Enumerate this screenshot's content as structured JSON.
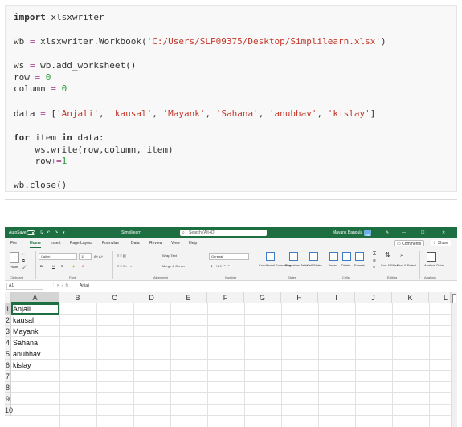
{
  "code": {
    "l1_kw": "import",
    "l1_rest": " xlsxwriter",
    "l2_a": "wb ",
    "l2_op": "=",
    "l2_b": " xlsxwriter.Workbook(",
    "l2_str": "'C:/Users/SLP09375/Desktop/Simplilearn.xlsx'",
    "l2_c": ")",
    "l3_a": "ws ",
    "l3_op": "=",
    "l3_b": " wb.add_worksheet()",
    "l4_a": "row ",
    "l4_op": "=",
    "l4_num": " 0",
    "l5_a": "column ",
    "l5_op": "=",
    "l5_num": " 0",
    "l6_a": "data ",
    "l6_op": "=",
    "l6_b": " [",
    "l6_s1": "'Anjali'",
    "l6_s2": "'kausal'",
    "l6_s3": "'Mayank'",
    "l6_s4": "'Sahana'",
    "l6_s5": "'anubhav'",
    "l6_s6": "'kislay'",
    "l6_comma": ", ",
    "l6_end": "]",
    "l7_kw1": "for",
    "l7_mid": " item ",
    "l7_kw2": "in",
    "l7_rest": " data:",
    "l8": "    ws.write(row,column, item)",
    "l9_a": "    row",
    "l9_op": "+=",
    "l9_num": "1",
    "l10": "wb.close()"
  },
  "excel": {
    "autosave": "AutoSave",
    "filename": "Simplilearn",
    "search_placeholder": "Search (Alt+Q)",
    "user_name": "Mayank Banoula",
    "user_initials": "MB",
    "window_controls": [
      "—",
      "☐",
      "✕"
    ],
    "menu": [
      "File",
      "Home",
      "Insert",
      "Page Layout",
      "Formulas",
      "Data",
      "Review",
      "View",
      "Help"
    ],
    "active_menu": "Home",
    "comments_label": "Comments",
    "share_label": "Share",
    "ribbon": {
      "paste": "Paste",
      "font_name": "Calibri",
      "font_size": "11",
      "wrap_text": "Wrap Text",
      "merge_center": "Merge & Center",
      "number_format": "General",
      "conditional_formatting": "Conditional Formatting",
      "format_as_table": "Format as Table",
      "cell_styles": "Cell Styles",
      "insert": "Insert",
      "delete": "Delete",
      "format": "Format",
      "sort_filter": "Sort & Filter",
      "find_select": "Find & Select",
      "analyze_data": "Analyze Data",
      "groups": [
        "Clipboard",
        "Font",
        "Alignment",
        "Number",
        "Styles",
        "Cells",
        "Editing",
        "Analysis"
      ]
    },
    "name_box": "A1",
    "formula_icons": "⋮   ✕   ✓   fx",
    "formula_value": "Anjali",
    "columns": [
      "A",
      "B",
      "C",
      "D",
      "E",
      "F",
      "G",
      "H",
      "I",
      "J",
      "K",
      "L"
    ],
    "rows": [
      "1",
      "2",
      "3",
      "4",
      "5",
      "6",
      "7",
      "8",
      "9",
      "10"
    ],
    "cells_a": [
      "Anjali",
      "kausal",
      "Mayank",
      "Sahana",
      "anubhav",
      "kislay"
    ]
  }
}
